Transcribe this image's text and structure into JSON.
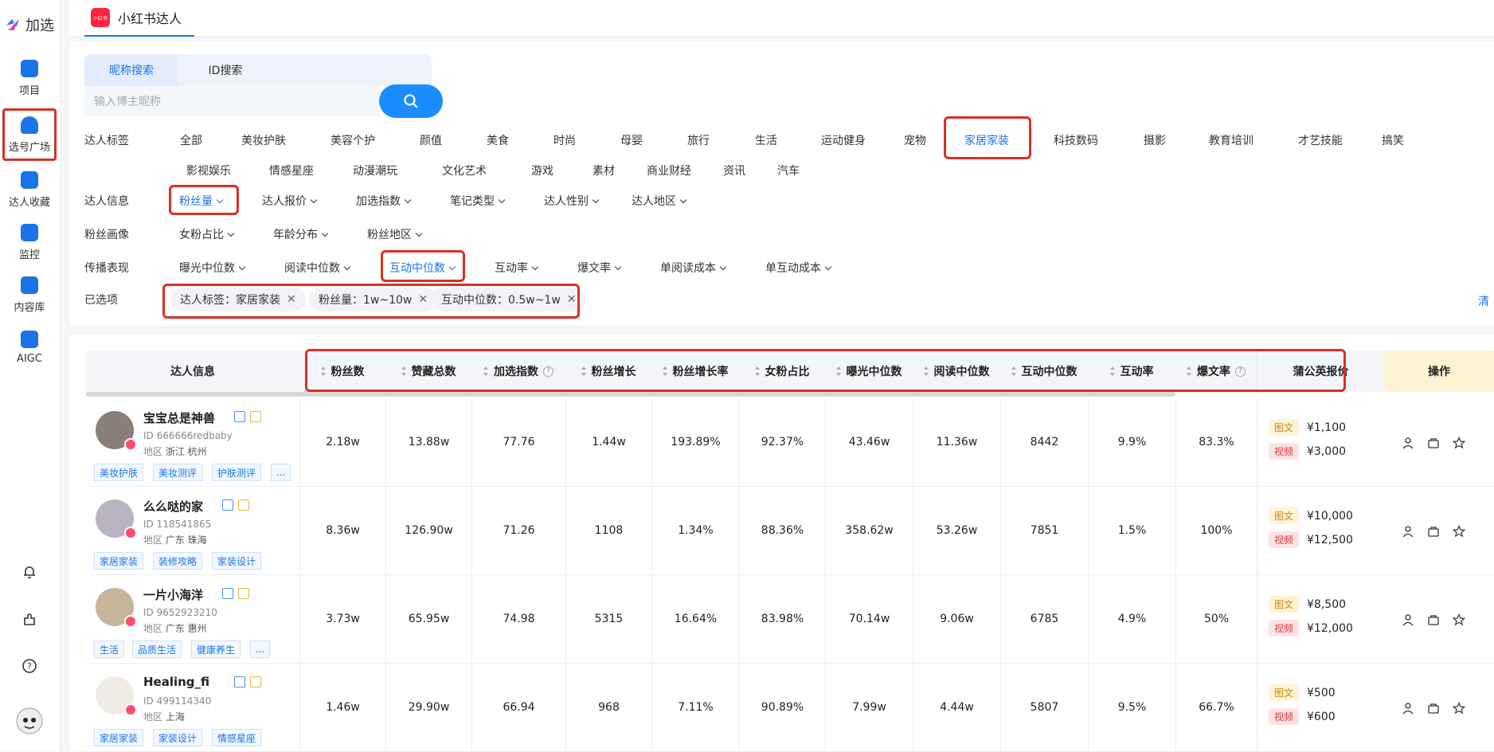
{
  "app": {
    "logo_text": "加选"
  },
  "sidebar": {
    "items": [
      {
        "label": "项目",
        "icon": "project-icon"
      },
      {
        "label": "选号广场",
        "icon": "user-square-icon"
      },
      {
        "label": "达人收藏",
        "icon": "star-folder-icon"
      },
      {
        "label": "监控",
        "icon": "monitor-icon"
      },
      {
        "label": "内容库",
        "icon": "library-icon"
      },
      {
        "label": "AIGC",
        "icon": "ai-icon"
      }
    ]
  },
  "top_tab": {
    "label": "小红书达人",
    "badge": "小红书"
  },
  "search": {
    "tab_nickname": "昵称搜索",
    "tab_id": "ID搜索",
    "placeholder": "输入博主昵称"
  },
  "filters": {
    "tags_label": "达人标签",
    "tags_row1": [
      "全部",
      "美妆护肤",
      "美容个护",
      "颜值",
      "美食",
      "时尚",
      "母婴",
      "旅行",
      "生活",
      "运动健身",
      "宠物",
      "家居家装",
      "科技数码",
      "摄影",
      "教育培训",
      "才艺技能",
      "搞笑"
    ],
    "tags_row2": [
      "影视娱乐",
      "情感星座",
      "动漫潮玩",
      "文化艺术",
      "游戏",
      "素材",
      "商业财经",
      "资讯",
      "汽车"
    ],
    "info_label": "达人信息",
    "info": [
      "粉丝量",
      "达人报价",
      "加选指数",
      "笔记类型",
      "达人性别",
      "达人地区"
    ],
    "fans_label": "粉丝画像",
    "fans": [
      "女粉占比",
      "年龄分布",
      "粉丝地区"
    ],
    "spread_label": "传播表现",
    "spread": [
      "曝光中位数",
      "阅读中位数",
      "互动中位数",
      "互动率",
      "爆文率",
      "单阅读成本",
      "单互动成本"
    ],
    "selected_label": "已选项",
    "selected": [
      "达人标签：家居家装",
      "粉丝量：1w~10w",
      "互动中位数：0.5w~1w"
    ],
    "clear": "清"
  },
  "table": {
    "headers": [
      "达人信息",
      "粉丝数",
      "赞藏总数",
      "加选指数",
      "粉丝增长",
      "粉丝增长率",
      "女粉占比",
      "曝光中位数",
      "阅读中位数",
      "互动中位数",
      "互动率",
      "爆文率",
      "蒲公英报价",
      "操作"
    ],
    "rows": [
      {
        "name": "宝宝总是神兽",
        "id": "ID 666666redbaby",
        "region_label": "地区",
        "region": "浙江 杭州",
        "tags": [
          "美妆护肤",
          "美妆测评",
          "护肤测评",
          "..."
        ],
        "values": [
          "2.18w",
          "13.88w",
          "77.76",
          "1.44w",
          "193.89%",
          "92.37%",
          "43.46w",
          "11.36w",
          "8442",
          "9.9%",
          "83.3%"
        ],
        "price_img": "¥1,100",
        "price_vid": "¥3,000"
      },
      {
        "name": "么么哒的家",
        "id": "ID 118541865",
        "region_label": "地区",
        "region": "广东 珠海",
        "tags": [
          "家居家装",
          "装修攻略",
          "家装设计"
        ],
        "values": [
          "8.36w",
          "126.90w",
          "71.26",
          "1108",
          "1.34%",
          "88.36%",
          "358.62w",
          "53.26w",
          "7851",
          "1.5%",
          "100%"
        ],
        "price_img": "¥10,000",
        "price_vid": "¥12,500"
      },
      {
        "name": "一片小海洋",
        "id": "ID 9652923210",
        "region_label": "地区",
        "region": "广东 惠州",
        "tags": [
          "生活",
          "品质生活",
          "健康养生",
          "..."
        ],
        "values": [
          "3.73w",
          "65.95w",
          "74.98",
          "5315",
          "16.64%",
          "83.98%",
          "70.14w",
          "9.06w",
          "6785",
          "4.9%",
          "50%"
        ],
        "price_img": "¥8,500",
        "price_vid": "¥12,000"
      },
      {
        "name": "Healing_fi",
        "id": "ID 499114340",
        "region_label": "地区",
        "region": "上海",
        "tags": [
          "家居家装",
          "家装设计",
          "情感星座"
        ],
        "values": [
          "1.46w",
          "29.90w",
          "66.94",
          "968",
          "7.11%",
          "90.89%",
          "7.99w",
          "4.44w",
          "5807",
          "9.5%",
          "66.7%"
        ],
        "price_img": "¥500",
        "price_vid": "¥600"
      }
    ],
    "price_img_label": "图文",
    "price_vid_label": "视频"
  },
  "colors": {
    "accent": "#1a74e8",
    "highlight_box": "#d93025",
    "brand_xhs": "#ff2442"
  }
}
